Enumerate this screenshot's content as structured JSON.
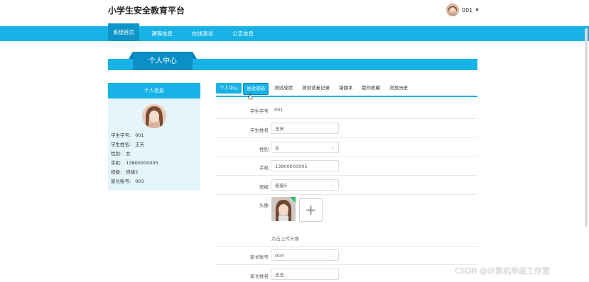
{
  "header": {
    "site_title": "小学生安全教育平台",
    "username": "001"
  },
  "nav": {
    "items": [
      "系统首页",
      "课程信息",
      "在线测试",
      "公告信息"
    ]
  },
  "page": {
    "title": "个人中心"
  },
  "left_panel": {
    "heading": "个人信息",
    "rows": [
      {
        "label": "学生学号:",
        "value": "001"
      },
      {
        "label": "学生姓名:",
        "value": "王天"
      },
      {
        "label": "性别:",
        "value": "女"
      },
      {
        "label": "手机:",
        "value": "13800000005"
      },
      {
        "label": "班级:",
        "value": "班级5"
      },
      {
        "label": "家长账号:",
        "value": "003"
      }
    ]
  },
  "tabs": [
    "个人中心",
    "修改密码",
    "测试成绩",
    "测试试卷记录",
    "错题本",
    "我的收藏",
    "浏览历史"
  ],
  "form": {
    "student_no_label": "学生学号",
    "student_no_value": "001",
    "student_name_label": "学生姓名",
    "student_name_value": "王天",
    "gender_label": "性别",
    "gender_value": "女",
    "phone_label": "手机",
    "phone_value": "13800000005",
    "class_label": "班级",
    "class_value": "班级5",
    "avatar_label": "头像",
    "upload_plus": "+",
    "upload_hint": "点击上传头像",
    "parent_account_label": "家长账号",
    "parent_account_value": "003",
    "parent_name_label": "家长姓名",
    "parent_name_value": "王五"
  },
  "watermark": "CSDN @计算机毕设工作室",
  "colors": {
    "primary": "#17b3e6",
    "primary_dark": "#0e95c9",
    "panel_bg": "#e6f5fc"
  }
}
